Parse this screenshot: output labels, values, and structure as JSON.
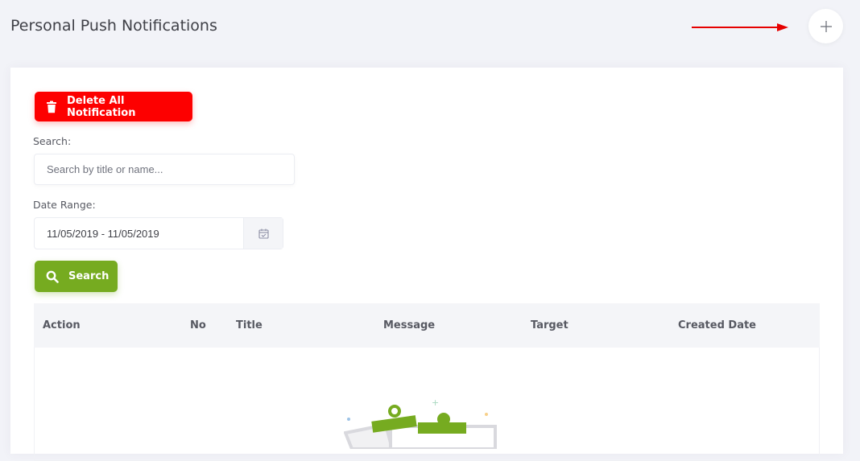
{
  "header": {
    "title": "Personal Push Notifications",
    "add_icon": "plus-icon",
    "arrow_color": "#e60000"
  },
  "toolbar": {
    "delete_label": "Delete All Notification",
    "delete_icon": "trash-icon",
    "delete_color": "#fd0000"
  },
  "search": {
    "label": "Search:",
    "placeholder": "Search by title or name...",
    "value": ""
  },
  "date_range": {
    "label": "Date Range:",
    "value": "11/05/2019 - 11/05/2019",
    "icon": "calendar-icon"
  },
  "search_button": {
    "label": "Search",
    "icon": "search-icon",
    "color": "#76ab20"
  },
  "table": {
    "columns": [
      "Action",
      "No",
      "Title",
      "Message",
      "Target",
      "Created Date"
    ],
    "rows": [],
    "empty_icon": "empty-clipboard-illustration"
  }
}
